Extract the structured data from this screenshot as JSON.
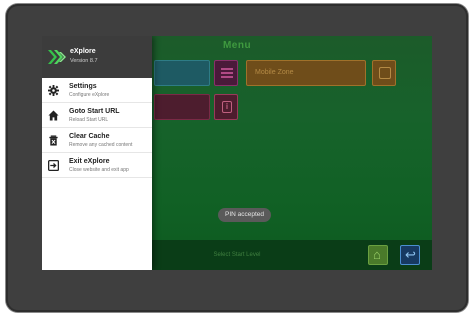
{
  "app": {
    "title": "Menu"
  },
  "tiles": {
    "orange_label": "Mobile Zone"
  },
  "toast": "PIN accepted",
  "bottom_bar": {
    "caption": "Select Start Level"
  },
  "drawer": {
    "app_name": "eXplore",
    "version": "Version 8.7",
    "items": [
      {
        "icon": "gear-icon",
        "label": "Settings",
        "sub": "Configure eXplore"
      },
      {
        "icon": "home-icon",
        "label": "Goto Start URL",
        "sub": "Reload Start URL"
      },
      {
        "icon": "trash-icon",
        "label": "Clear Cache",
        "sub": "Remove any cached content"
      },
      {
        "icon": "exit-icon",
        "label": "Exit eXplore",
        "sub": "Close website and exit app"
      }
    ]
  },
  "colors": {
    "accent_green": "#35c24a",
    "drawer_header": "#3c3c3c",
    "screen_bg": "#17622b"
  }
}
